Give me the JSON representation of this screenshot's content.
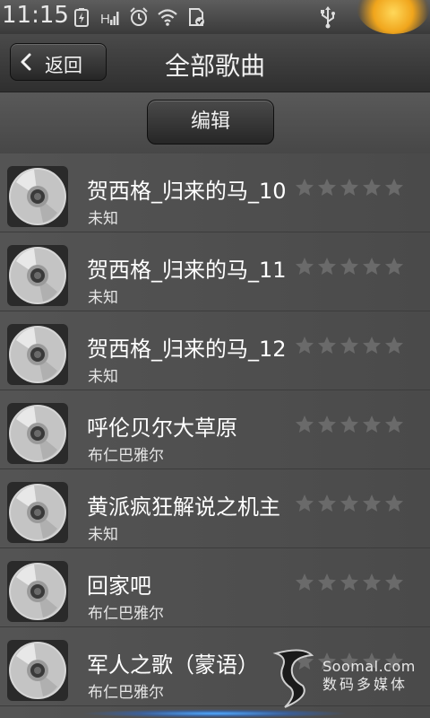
{
  "status_bar": {
    "time": "11:15",
    "icons": [
      "battery-charging-icon",
      "signal-icon",
      "alarm-icon",
      "wifi-icon",
      "sd-card-icon",
      "usb-icon"
    ]
  },
  "header": {
    "back_label": "返回",
    "title": "全部歌曲"
  },
  "toolbar": {
    "edit_label": "编辑"
  },
  "songs": [
    {
      "title": "贺西格_归来的马_10",
      "artist": "未知",
      "rating": 0
    },
    {
      "title": "贺西格_归来的马_11",
      "artist": "未知",
      "rating": 0
    },
    {
      "title": "贺西格_归来的马_12",
      "artist": "未知",
      "rating": 0
    },
    {
      "title": "呼伦贝尔大草原",
      "artist": "布仁巴雅尔",
      "rating": 0
    },
    {
      "title": "黄派疯狂解说之机主",
      "artist": "未知",
      "rating": 0
    },
    {
      "title": "回家吧",
      "artist": "布仁巴雅尔",
      "rating": 0
    },
    {
      "title": "军人之歌（蒙语）",
      "artist": "布仁巴雅尔",
      "rating": 0
    }
  ],
  "watermark": {
    "site": "Soomal.com",
    "subtitle": "数码多媒体"
  },
  "colors": {
    "accent": "#f0a51c",
    "background": "#4f4f4f",
    "star_empty": "#6a6a6a"
  }
}
